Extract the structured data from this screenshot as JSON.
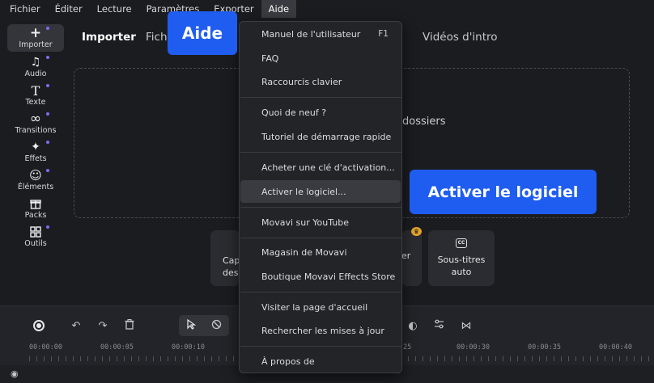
{
  "menubar": {
    "items": [
      "Fichier",
      "Éditer",
      "Lecture",
      "Paramètres",
      "Exporter",
      "Aide"
    ]
  },
  "sidebar": {
    "items": [
      {
        "label": "Importer",
        "icon": "plus-icon"
      },
      {
        "label": "Audio",
        "icon": "music-note-icon"
      },
      {
        "label": "Texte",
        "icon": "text-icon"
      },
      {
        "label": "Transitions",
        "icon": "infinity-icon"
      },
      {
        "label": "Effets",
        "icon": "sparkle-icon"
      },
      {
        "label": "Éléments",
        "icon": "smiley-icon"
      },
      {
        "label": "Packs",
        "icon": "gift-icon"
      },
      {
        "label": "Outils",
        "icon": "grid-icon"
      }
    ]
  },
  "tabs": {
    "importer": "Importer",
    "fichiers": "Fichi",
    "videos_intro": "Vidéos d'intro"
  },
  "dropzone": {
    "text": "dossiers"
  },
  "cards": {
    "capture_line1": "Cap",
    "capture_line2": "des",
    "middle_partial": "er",
    "subtitles_line1": "Sous-titres",
    "subtitles_line2": "auto",
    "subtitles_icon_text": "CC"
  },
  "dropdown": {
    "items": [
      {
        "label": "Manuel de l'utilisateur",
        "shortcut": "F1"
      },
      {
        "label": "FAQ"
      },
      {
        "label": "Raccourcis clavier"
      },
      {
        "label": "Quoi de neuf ?"
      },
      {
        "label": "Tutoriel de démarrage rapide"
      },
      {
        "label": "Acheter une clé d'activation..."
      },
      {
        "label": "Activer le logiciel..."
      },
      {
        "label": "Movavi sur YouTube"
      },
      {
        "label": "Magasin de Movavi"
      },
      {
        "label": "Boutique Movavi Effects Store"
      },
      {
        "label": "Visiter la page d'accueil"
      },
      {
        "label": "Rechercher les mises à jour"
      },
      {
        "label": "À propos de"
      }
    ]
  },
  "timeline": {
    "ticks": [
      "00:00:00",
      "00:00:05",
      "00:00:10",
      "25",
      "00:00:30",
      "00:00:35",
      "00:00:40"
    ]
  },
  "callouts": {
    "aide": "Aide",
    "activer": "Activer le logiciel"
  },
  "colors": {
    "accent": "#1f5df0",
    "background": "#1b1c20",
    "menu_bg": "#232428",
    "highlight": "#3a3b41",
    "crown": "#e4a62a"
  }
}
